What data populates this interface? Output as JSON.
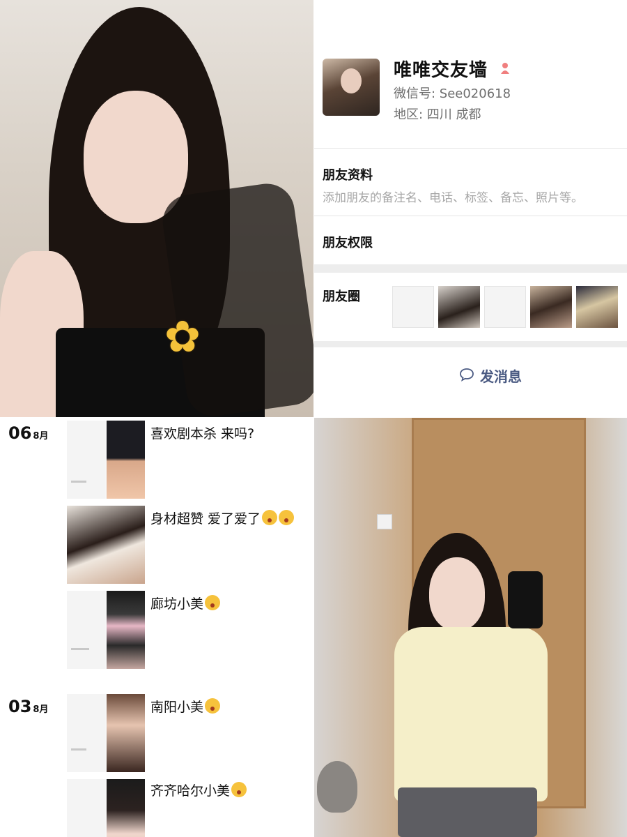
{
  "profile": {
    "nickname": "唯唯交友墙",
    "wechat_id": "微信号: See020618",
    "region": "地区: 四川 成都",
    "gender_icon": "female-icon",
    "friend_info_title": "朋友资料",
    "friend_info_sub": "添加朋友的备注名、电话、标签、备忘、照片等。",
    "friend_permission_title": "朋友权限",
    "moments_title": "朋友圈",
    "send_message_label": "发消息",
    "send_icon": "chat-bubble-icon",
    "accent_color": "#4a5a82"
  },
  "moments": [
    {
      "day": "06",
      "month": "8月",
      "posts": [
        {
          "text": "喜欢剧本杀 来吗?",
          "emojis": 0
        },
        {
          "text": "身材超赞 爱了爱了",
          "emojis": 2
        },
        {
          "text": "廊坊小美",
          "emojis": 1
        }
      ]
    },
    {
      "day": "03",
      "month": "8月",
      "posts": [
        {
          "text": "南阳小美",
          "emojis": 1
        },
        {
          "text": "齐齐哈尔小美",
          "emojis": 1
        }
      ]
    }
  ]
}
